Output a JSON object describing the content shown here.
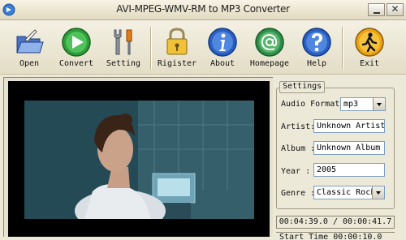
{
  "window": {
    "title": "AVI-MPEG-WMV-RM to MP3 Converter",
    "close_glyph": "✕"
  },
  "toolbar": {
    "buttons": [
      {
        "id": "open",
        "label": "Open",
        "icon": "open-folder-icon"
      },
      {
        "id": "convert",
        "label": "Convert",
        "icon": "play-convert-icon"
      },
      {
        "id": "setting",
        "label": "Setting",
        "icon": "wrench-screwdriver-icon"
      },
      {
        "id": "register",
        "label": "Rigister",
        "icon": "padlock-icon"
      },
      {
        "id": "about",
        "label": "About",
        "icon": "info-icon"
      },
      {
        "id": "homepage",
        "label": "Homepage",
        "icon": "at-sign-icon"
      },
      {
        "id": "help",
        "label": "Help",
        "icon": "question-icon"
      },
      {
        "id": "exit",
        "label": "Exit",
        "icon": "exit-running-man-icon"
      }
    ]
  },
  "settings": {
    "legend": "Settings",
    "audio_format_label": "Audio Format:",
    "audio_format_value": "mp3",
    "artist_label": "Artist:",
    "artist_value": "Unknown Artist",
    "album_label": "Album :",
    "album_value": "Unknown Album",
    "year_label": "Year  :",
    "year_value": "2005",
    "genre_label": "Genre :",
    "genre_value": "Classic Rock"
  },
  "status": {
    "time": "00:04:39.0 / 00:00:41.7",
    "second_line": "Start Time  00:00:10.0"
  },
  "colors": {
    "accent_green": "#2f9b3a",
    "accent_blue": "#2a5fc0",
    "background": "#ece9d8"
  }
}
